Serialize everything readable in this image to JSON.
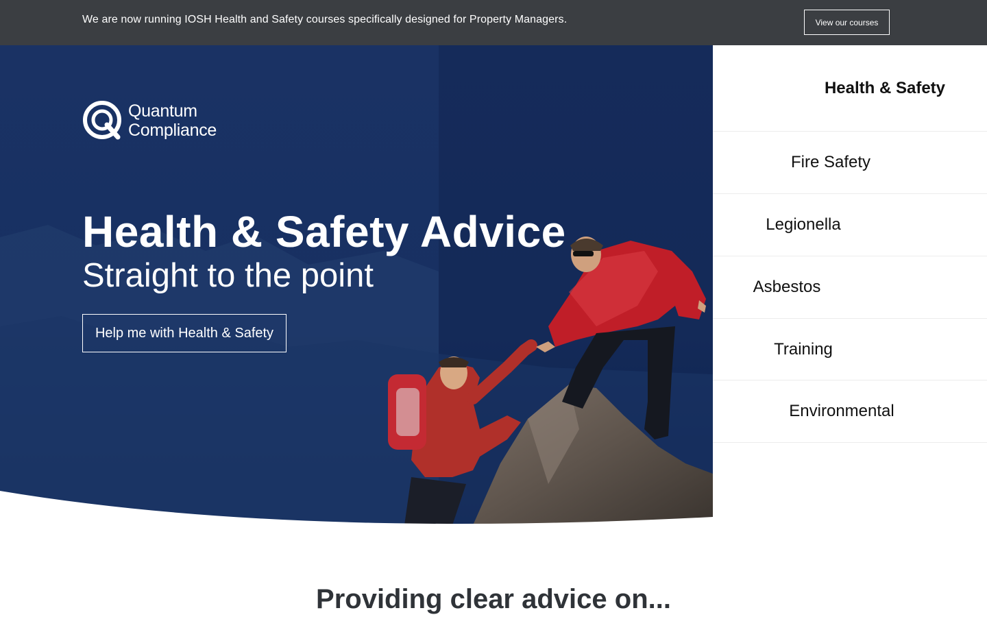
{
  "announcement": {
    "text": "We are now running IOSH Health and Safety courses specifically designed for Property Managers.",
    "button_label": "View our courses"
  },
  "logo": {
    "line1": "Quantum",
    "line2": "Compliance",
    "icon": "quantum-q-logo-icon"
  },
  "hero": {
    "title": "Health & Safety Advice",
    "subtitle": "Straight to the point",
    "cta_label": "Help me with Health & Safety",
    "image": "climbers-helping-hand-photo"
  },
  "nav": {
    "items": [
      {
        "label": "Health & Safety",
        "active": true
      },
      {
        "label": "Fire Safety",
        "active": false
      },
      {
        "label": "Legionella",
        "active": false
      },
      {
        "label": "Asbestos",
        "active": false
      },
      {
        "label": "Training",
        "active": false
      },
      {
        "label": "Environmental",
        "active": false
      }
    ]
  },
  "section": {
    "heading": "Providing clear advice on..."
  },
  "colors": {
    "topbar_bg": "#3b3e42",
    "hero_navy": "#14295a",
    "jacket_red": "#c01e28",
    "heading_text": "#2f3338"
  }
}
